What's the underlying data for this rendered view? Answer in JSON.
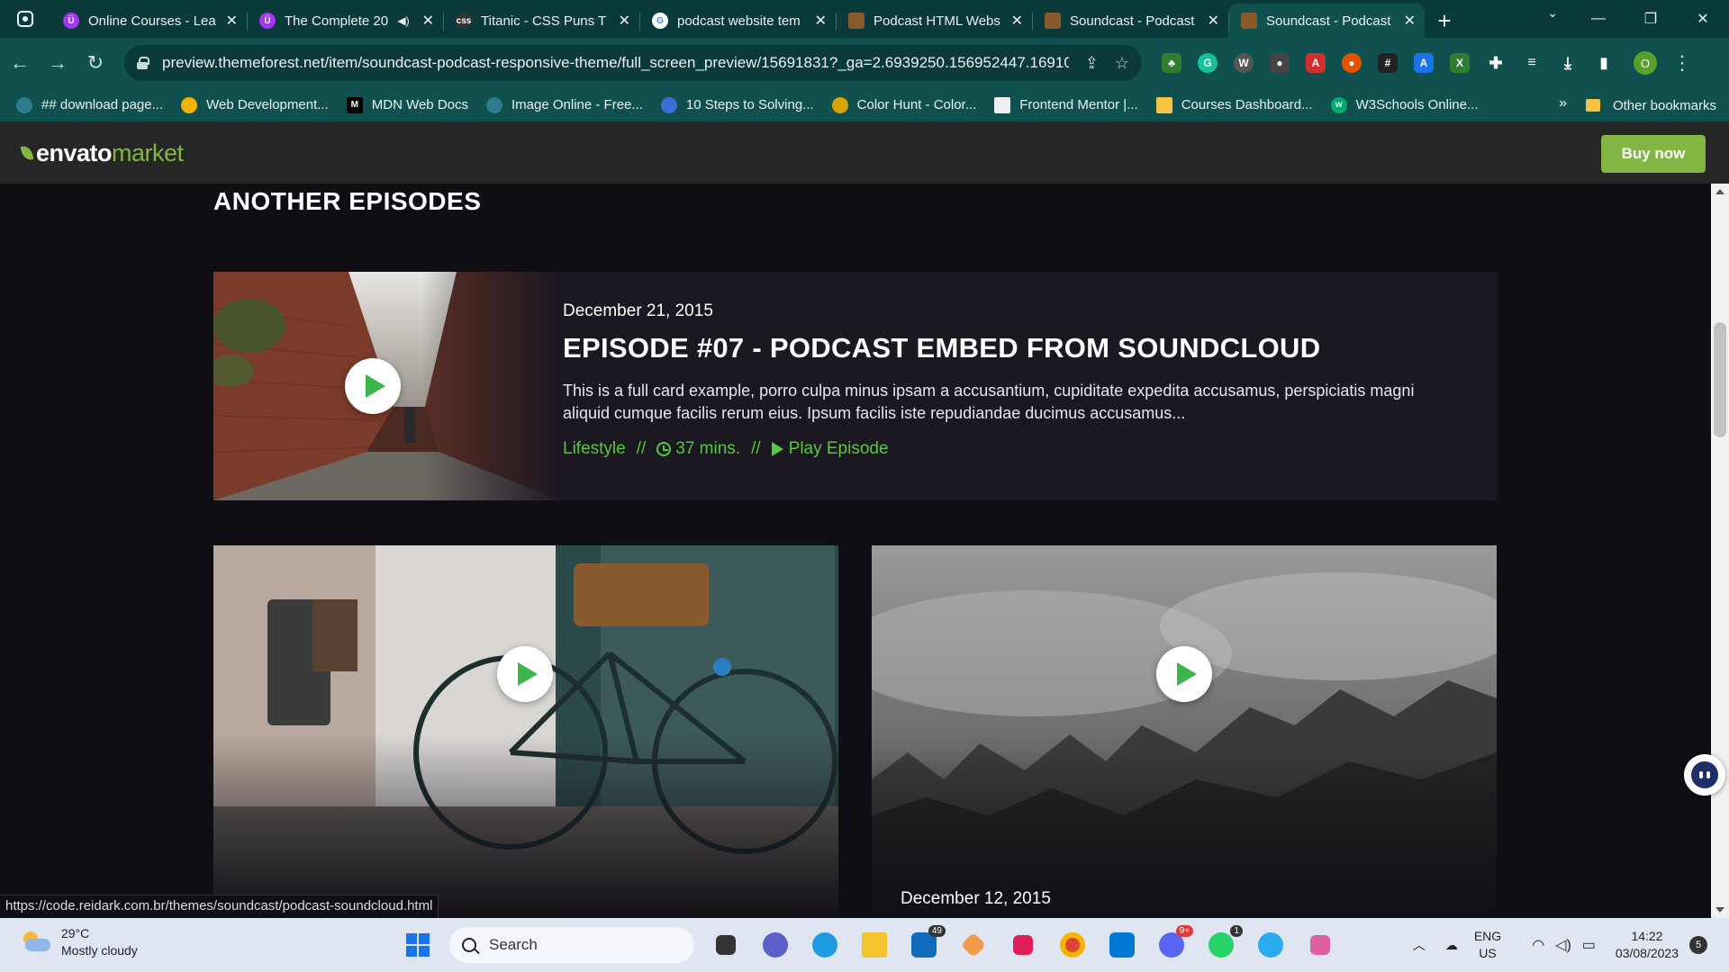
{
  "browser": {
    "tabs": [
      {
        "title": "Online Courses - Lea",
        "favicon": "udemy-icon",
        "color": "#a435f0",
        "active": false
      },
      {
        "title": "The Complete 20",
        "favicon": "udemy-icon",
        "color": "#a435f0",
        "active": false,
        "audio": true
      },
      {
        "title": "Titanic - CSS Puns T",
        "favicon": "css-icon",
        "color": "#333333",
        "active": false
      },
      {
        "title": "podcast website tem",
        "favicon": "google-icon",
        "color": "#ffffff",
        "active": false
      },
      {
        "title": "Podcast HTML Webs",
        "favicon": "themeforest-icon",
        "color": "#8a5a2b",
        "active": false
      },
      {
        "title": "Soundcast - Podcast",
        "favicon": "themeforest-icon",
        "color": "#8a5a2b",
        "active": false
      },
      {
        "title": "Soundcast - Podcast",
        "favicon": "themeforest-icon",
        "color": "#8a5a2b",
        "active": true
      }
    ],
    "url": "preview.themeforest.net/item/soundcast-podcast-responsive-theme/full_screen_preview/15691831?_ga=2.6939250.156952447.16910...",
    "profile_initial": "O",
    "bookmarks": [
      {
        "label": "## download page...",
        "color": "#2e7d8c"
      },
      {
        "label": "Web Development...",
        "color": "#f0b400"
      },
      {
        "label": "MDN Web Docs",
        "color": "#000000"
      },
      {
        "label": "Image Online - Free...",
        "color": "#2e7d8c"
      },
      {
        "label": "10 Steps to Solving...",
        "color": "#3a6fd8"
      },
      {
        "label": "Color Hunt - Color...",
        "color": "#d9a400"
      },
      {
        "label": "Frontend Mentor |...",
        "color": "#eeeeee"
      },
      {
        "label": "Courses Dashboard...",
        "color": "#f5c542"
      },
      {
        "label": "W3Schools Online...",
        "color": "#04aa6d"
      }
    ],
    "other_bookmarks": "Other bookmarks",
    "status_url": "https://code.reidark.com.br/themes/soundcast/podcast-soundcloud.html"
  },
  "envato": {
    "logo_part1": "envato",
    "logo_part2": "market",
    "buy_label": "Buy now"
  },
  "page": {
    "section_title": "ANOTHER EPISODES",
    "featured": {
      "date": "December 21, 2015",
      "title": "EPISODE #07 - PODCAST EMBED FROM SOUNDCLOUD",
      "description": "This is a full card example, porro culpa minus ipsam a accusantium, cupiditate expedita accusamus, perspiciatis magni aliquid cumque facilis rerum eius. Ipsum facilis iste repudiandae ducimus accusamus...",
      "category": "Lifestyle",
      "duration": "37 mins.",
      "play_label": "Play Episode",
      "separator": "//"
    },
    "card2_date": "December 12, 2015"
  },
  "taskbar": {
    "weather_temp": "29°C",
    "weather_desc": "Mostly cloudy",
    "search_placeholder": "Search",
    "lang1": "ENG",
    "lang2": "US",
    "time": "14:22",
    "date": "03/08/2023",
    "notifications": "5",
    "badges": {
      "store": "49",
      "discord": "9+",
      "whatsapp": "1"
    }
  }
}
